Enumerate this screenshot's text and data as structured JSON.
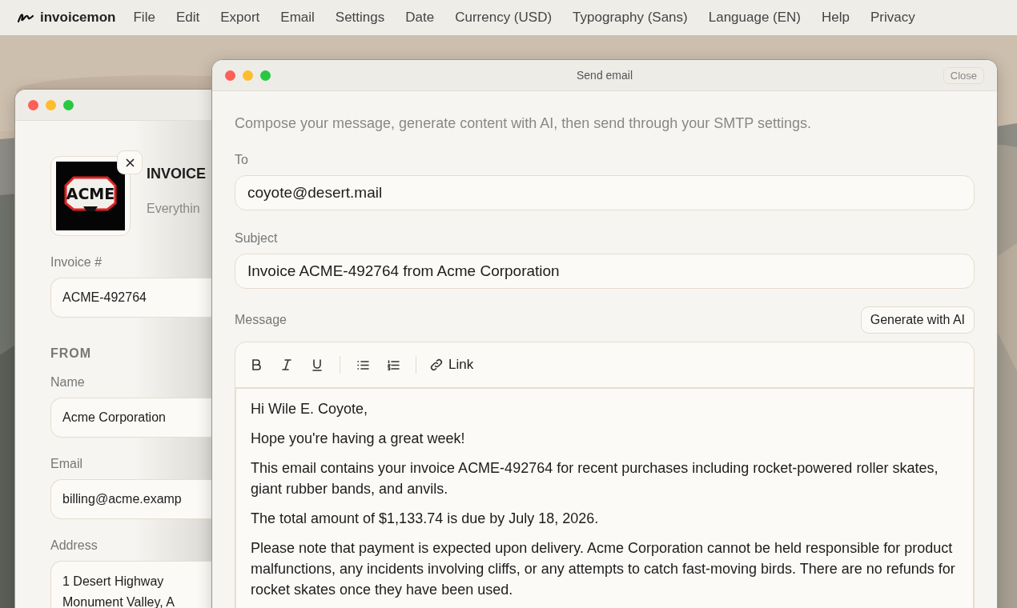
{
  "menu_bar": {
    "app_name": "invoicemon",
    "items": [
      "File",
      "Edit",
      "Export",
      "Email",
      "Settings",
      "Date",
      "Currency (USD)",
      "Typography (Sans)",
      "Language (EN)",
      "Help",
      "Privacy"
    ]
  },
  "invoice_window": {
    "logo_text": "ACME",
    "title": "INVOICE",
    "tagline": "Everythin",
    "invoice_number": {
      "label": "Invoice #",
      "value": "ACME-492764"
    },
    "section": "FROM",
    "fields": [
      {
        "label": "Name",
        "value": "Acme Corporation",
        "kind": "line"
      },
      {
        "label": "Email",
        "value": "billing@acme.examp",
        "kind": "line"
      },
      {
        "label": "Address",
        "value": "1 Desert Highway\nMonument Valley, A",
        "kind": "multiline"
      }
    ]
  },
  "email_window": {
    "title": "Send email",
    "close": "Close",
    "description": "Compose your message, generate content with AI, then send through your SMTP settings.",
    "to": {
      "label": "To",
      "value": "coyote@desert.mail"
    },
    "subject": {
      "label": "Subject",
      "value": "Invoice ACME-492764 from Acme Corporation"
    },
    "message_label": "Message",
    "generate_button": "Generate with AI",
    "toolbar": [
      {
        "kind": "bold"
      },
      {
        "kind": "italic"
      },
      {
        "kind": "underline"
      },
      {
        "kind": "divider"
      },
      {
        "kind": "bullets"
      },
      {
        "kind": "numbers"
      },
      {
        "kind": "divider"
      },
      {
        "kind": "link",
        "label": "Link"
      }
    ],
    "body": [
      "Hi Wile E. Coyote,",
      "Hope you're having a great week!",
      "This email contains your invoice ACME-492764 for recent purchases including rocket-powered roller skates, giant rubber bands, and anvils.",
      "The total amount of $1,133.74 is due by July 18, 2026.",
      "Please note that payment is expected upon delivery. Acme Corporation cannot be held responsible for product malfunctions, any incidents involving cliffs, or any attempts to catch fast-moving birds. There are no refunds for rocket skates once they have been used."
    ]
  }
}
